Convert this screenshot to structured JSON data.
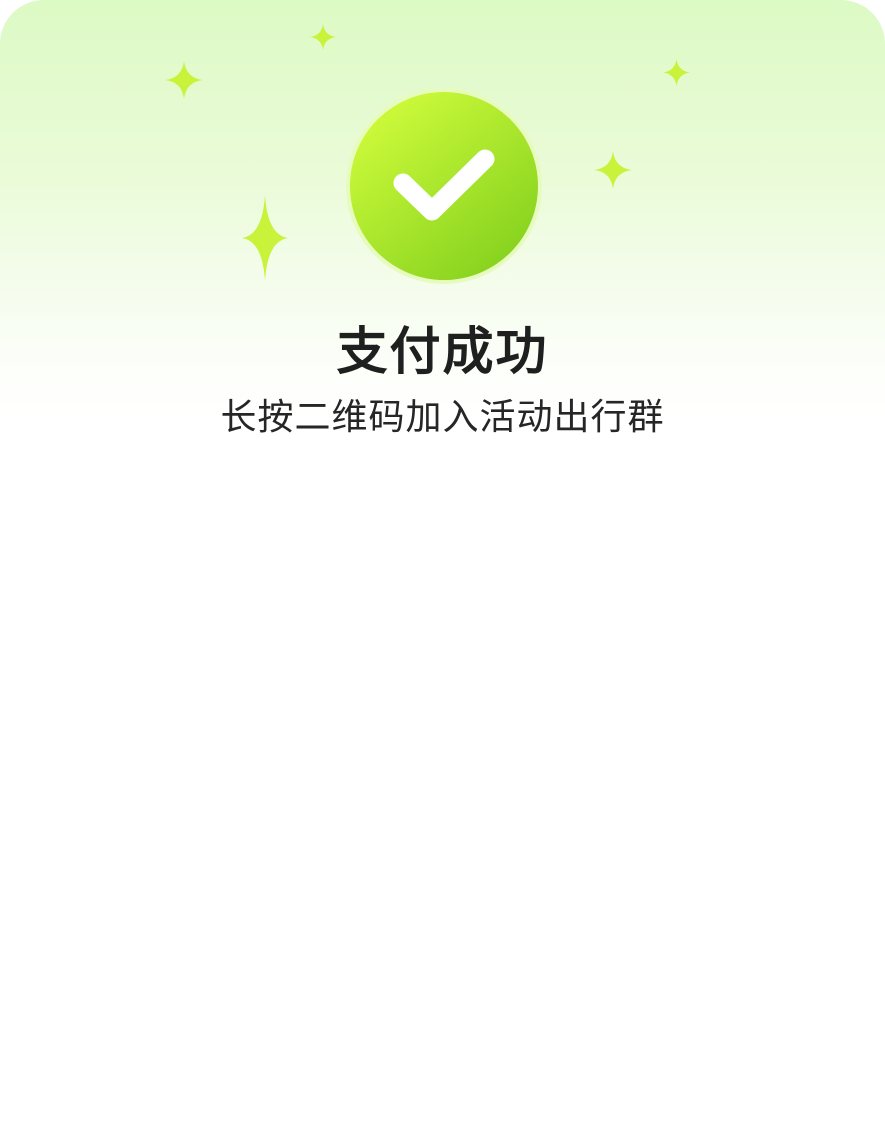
{
  "status": {
    "title": "支付成功",
    "subtitle": "长按二维码加入活动出行群",
    "icon": "check-circle-icon"
  },
  "colors": {
    "accent": "#b6ec2a",
    "accent_dark": "#86d51f",
    "sparkle": "#c9f23a",
    "background_top": "#dcfac4",
    "title_text": "#1f1f1f"
  }
}
